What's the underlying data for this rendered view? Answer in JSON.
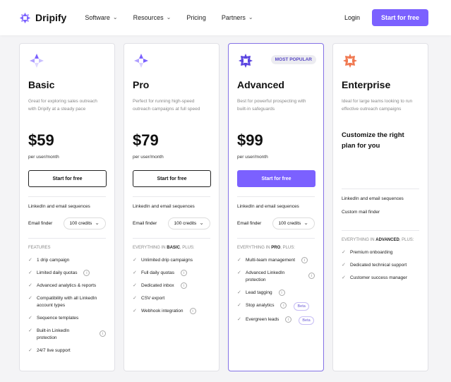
{
  "brand": {
    "name": "Dripify",
    "accent": "#7b61ff"
  },
  "nav": {
    "items": [
      {
        "label": "Software",
        "dropdown": true
      },
      {
        "label": "Resources",
        "dropdown": true
      },
      {
        "label": "Pricing",
        "dropdown": false
      },
      {
        "label": "Partners",
        "dropdown": true
      }
    ],
    "login": "Login",
    "cta": "Start for free"
  },
  "plans": [
    {
      "name": "Basic",
      "desc": "Great for exploring sales outreach with Dripify at a steady pace",
      "price": "$59",
      "per": "per user/month",
      "button": "Start for free",
      "line1": "LinkedIn and email sequences",
      "finder_label": "Email finder",
      "finder_value": "100 credits",
      "section_prefix": "FEATURES",
      "section_bold": "",
      "section_suffix": "",
      "features": [
        {
          "text": "1 drip campaign",
          "info": false
        },
        {
          "text": "Limited daily quotas",
          "info": true
        },
        {
          "text": "Advanced analytics & reports",
          "info": false
        },
        {
          "text": "Compatibility with all LinkedIn account types",
          "info": false
        },
        {
          "text": "Sequence templates",
          "info": false
        },
        {
          "text": "Built-in LinkedIn protection",
          "info": true
        },
        {
          "text": "24/7 live support",
          "info": false
        }
      ]
    },
    {
      "name": "Pro",
      "desc": "Perfect for running high-speed outreach campaigns at full speed",
      "price": "$79",
      "per": "per user/month",
      "button": "Start for free",
      "line1": "LinkedIn and email sequences",
      "finder_label": "Email finder",
      "finder_value": "100 credits",
      "section_prefix": "EVERYTHING IN ",
      "section_bold": "BASIC",
      "section_suffix": ", PLUS:",
      "features": [
        {
          "text": "Unlimited drip campaigns",
          "info": false
        },
        {
          "text": "Full daily quotas",
          "info": true
        },
        {
          "text": "Dedicated inbox",
          "info": true
        },
        {
          "text": "CSV export",
          "info": false
        },
        {
          "text": "Webhook integration",
          "info": true
        }
      ]
    },
    {
      "name": "Advanced",
      "badge": "MOST POPULAR",
      "desc": "Best for powerful prospecting with built-in safeguards",
      "price": "$99",
      "per": "per user/month",
      "button": "Start for free",
      "line1": "LinkedIn and email sequences",
      "finder_label": "Email finder",
      "finder_value": "100 credits",
      "section_prefix": "EVERYTHING IN ",
      "section_bold": "PRO",
      "section_suffix": ", PLUS:",
      "features": [
        {
          "text": "Multi-team management",
          "info": true
        },
        {
          "text": "Advanced LinkedIn protection",
          "info": true
        },
        {
          "text": "Lead tagging",
          "info": true
        },
        {
          "text": "Stop analytics",
          "info": true,
          "beta": "Beta"
        },
        {
          "text": "Evergreen leads",
          "info": true,
          "beta": "Beta"
        }
      ]
    },
    {
      "name": "Enterprise",
      "desc": "Ideal for large teams looking to run effective outreach campaigns",
      "cta_title": "Customize the right plan for you",
      "line1": "LinkedIn and email sequences",
      "line2": "Custom mail finder",
      "section_prefix": "EVERYTHING IN ",
      "section_bold": "ADVANCED",
      "section_suffix": ", PLUS:",
      "features": [
        {
          "text": "Premium onboarding",
          "info": false
        },
        {
          "text": "Dedicated technical support",
          "info": false
        },
        {
          "text": "Customer success manager",
          "info": false
        }
      ]
    }
  ]
}
